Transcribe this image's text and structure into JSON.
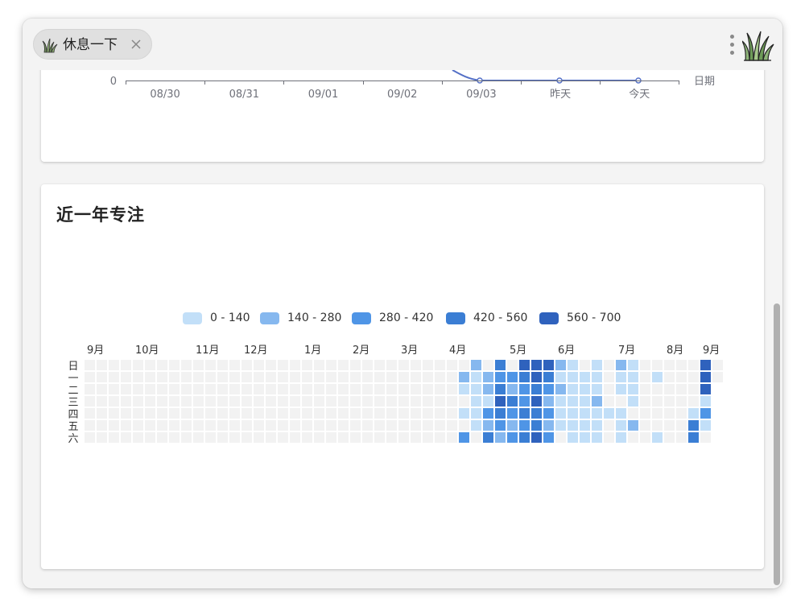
{
  "tab": {
    "label": "休息一下",
    "icon": "grass-icon"
  },
  "toolbar": {
    "menu_icon": "more-vert-icon",
    "logo_icon": "grass-logo-icon"
  },
  "line_chart": {
    "y_tick": "0",
    "x_axis_name": "日期",
    "x_labels": [
      "08/30",
      "08/31",
      "09/01",
      "09/02",
      "09/03",
      "昨天",
      "今天"
    ],
    "line_color": "#5470c6"
  },
  "heatmap_card": {
    "title": "近一年专注"
  },
  "legend": [
    {
      "label": "0 - 140",
      "color": "#c2dff8"
    },
    {
      "label": "140 - 280",
      "color": "#86b8ef"
    },
    {
      "label": "280 - 420",
      "color": "#4f95e6"
    },
    {
      "label": "420 - 560",
      "color": "#3b7ed4"
    },
    {
      "label": "560 - 700",
      "color": "#2f62bd"
    }
  ],
  "chart_data": {
    "type": "heatmap",
    "title": "近一年专注",
    "month_labels": [
      {
        "week": 1,
        "label": "9月"
      },
      {
        "week": 5,
        "label": "10月"
      },
      {
        "week": 10,
        "label": "11月"
      },
      {
        "week": 14,
        "label": "12月"
      },
      {
        "week": 19,
        "label": "1月"
      },
      {
        "week": 23,
        "label": "2月"
      },
      {
        "week": 27,
        "label": "3月"
      },
      {
        "week": 31,
        "label": "4月"
      },
      {
        "week": 36,
        "label": "5月"
      },
      {
        "week": 40,
        "label": "6月"
      },
      {
        "week": 45,
        "label": "7月"
      },
      {
        "week": 49,
        "label": "8月"
      },
      {
        "week": 52,
        "label": "9月"
      }
    ],
    "weekday_labels": [
      "日",
      "一",
      "二",
      "三",
      "四",
      "五",
      "六"
    ],
    "level_ranges": [
      "0 - 140",
      "140 - 280",
      "280 - 420",
      "420 - 560",
      "560 - 700"
    ],
    "empty_color": "#f2f2f2",
    "weeks": 53,
    "active_cells": [
      [
        32,
        0,
        2
      ],
      [
        34,
        0,
        4
      ],
      [
        36,
        0,
        5
      ],
      [
        37,
        0,
        5
      ],
      [
        38,
        0,
        5
      ],
      [
        39,
        0,
        2
      ],
      [
        40,
        0,
        1
      ],
      [
        42,
        0,
        1
      ],
      [
        44,
        0,
        2
      ],
      [
        45,
        0,
        1
      ],
      [
        51,
        0,
        5
      ],
      [
        31,
        1,
        2
      ],
      [
        32,
        1,
        1
      ],
      [
        33,
        1,
        2
      ],
      [
        34,
        1,
        3
      ],
      [
        35,
        1,
        3
      ],
      [
        36,
        1,
        4
      ],
      [
        37,
        1,
        5
      ],
      [
        38,
        1,
        4
      ],
      [
        39,
        1,
        1
      ],
      [
        40,
        1,
        1
      ],
      [
        41,
        1,
        1
      ],
      [
        42,
        1,
        1
      ],
      [
        44,
        1,
        1
      ],
      [
        45,
        1,
        1
      ],
      [
        47,
        1,
        1
      ],
      [
        51,
        1,
        5
      ],
      [
        31,
        2,
        1
      ],
      [
        32,
        2,
        1
      ],
      [
        33,
        2,
        2
      ],
      [
        34,
        2,
        4
      ],
      [
        35,
        2,
        2
      ],
      [
        36,
        2,
        3
      ],
      [
        37,
        2,
        4
      ],
      [
        38,
        2,
        3
      ],
      [
        39,
        2,
        2
      ],
      [
        40,
        2,
        1
      ],
      [
        41,
        2,
        1
      ],
      [
        42,
        2,
        1
      ],
      [
        44,
        2,
        1
      ],
      [
        45,
        2,
        1
      ],
      [
        51,
        2,
        5
      ],
      [
        32,
        3,
        1
      ],
      [
        33,
        3,
        1
      ],
      [
        34,
        3,
        5
      ],
      [
        35,
        3,
        4
      ],
      [
        36,
        3,
        3
      ],
      [
        37,
        3,
        5
      ],
      [
        38,
        3,
        2
      ],
      [
        39,
        3,
        1
      ],
      [
        40,
        3,
        1
      ],
      [
        41,
        3,
        1
      ],
      [
        42,
        3,
        2
      ],
      [
        45,
        3,
        1
      ],
      [
        51,
        3,
        1
      ],
      [
        31,
        4,
        1
      ],
      [
        32,
        4,
        1
      ],
      [
        33,
        4,
        3
      ],
      [
        34,
        4,
        4
      ],
      [
        35,
        4,
        3
      ],
      [
        36,
        4,
        4
      ],
      [
        37,
        4,
        4
      ],
      [
        38,
        4,
        3
      ],
      [
        39,
        4,
        1
      ],
      [
        40,
        4,
        1
      ],
      [
        41,
        4,
        1
      ],
      [
        42,
        4,
        1
      ],
      [
        43,
        4,
        1
      ],
      [
        44,
        4,
        1
      ],
      [
        50,
        4,
        1
      ],
      [
        51,
        4,
        3
      ],
      [
        32,
        5,
        1
      ],
      [
        33,
        5,
        2
      ],
      [
        34,
        5,
        3
      ],
      [
        35,
        5,
        2
      ],
      [
        36,
        5,
        3
      ],
      [
        37,
        5,
        4
      ],
      [
        38,
        5,
        2
      ],
      [
        39,
        5,
        1
      ],
      [
        40,
        5,
        1
      ],
      [
        41,
        5,
        1
      ],
      [
        42,
        5,
        1
      ],
      [
        44,
        5,
        1
      ],
      [
        45,
        5,
        2
      ],
      [
        50,
        5,
        4
      ],
      [
        51,
        5,
        1
      ],
      [
        31,
        6,
        3
      ],
      [
        33,
        6,
        4
      ],
      [
        34,
        6,
        2
      ],
      [
        35,
        6,
        3
      ],
      [
        36,
        6,
        4
      ],
      [
        37,
        6,
        5
      ],
      [
        38,
        6,
        3
      ],
      [
        40,
        6,
        1
      ],
      [
        41,
        6,
        1
      ],
      [
        42,
        6,
        1
      ],
      [
        44,
        6,
        1
      ],
      [
        47,
        6,
        1
      ],
      [
        50,
        6,
        4
      ]
    ]
  }
}
